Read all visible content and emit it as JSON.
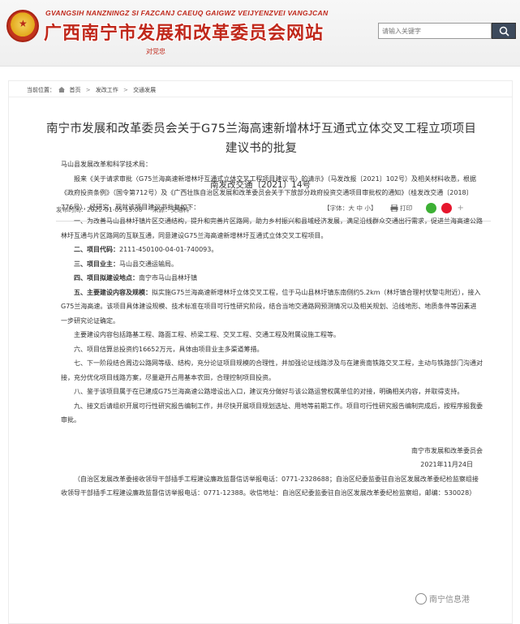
{
  "header": {
    "site_subtitle": "GVANGSIH NANZNINGZ SI FAZCANJ CAEUQ GAIGWZ VEIJYENZVEI VANGJCAN",
    "site_title": "广西南宁市发展和改革委员会网站",
    "slogan": "对党忠",
    "search_placeholder": "请输入关键字"
  },
  "breadcrumb": {
    "label": "当前位置：",
    "items": [
      "首页",
      "发改工作",
      "交通发展"
    ]
  },
  "document": {
    "title": "南宁市发展和改革委员会关于G75兰海高速新增林圩互通式立体交叉工程立项项目建议书的批复",
    "doc_number": "南发改交通〔2021〕14号",
    "publish_time": "发布时间：2022-01-05 15:08",
    "source": "来源：交通科",
    "font_size_tool": "【字体：大 中 小】",
    "print_label": "打印",
    "share_more": "+"
  },
  "body": {
    "addressee": "马山县发展改革和科学技术局：",
    "para1": "报来《关于请求审批〈G75兰海高速新增林圩互通式立体交叉工程项目建议书〉的请示》（马发改报〔2021〕102号）及相关材料收悉，根据《政府投资条例》（国令第712号）及《广西壮族自治区发展和改革委员会关于下放部分政府投资交通项目审批权的通知》（桂发改交通〔2018〕776号），经研究，现就该项目建议书批复如下：",
    "para2": "一、为改善马山县林圩镇片区交通结构，提升和完善片区路网，助力乡村振兴和县域经济发展，满足沿线群众交通出行需求，促进兰海高速公路林圩互通与片区路网的互联互通，同意建设G75兰海高速新增林圩互通式立体交叉工程项目。",
    "item2_label": "二、项目代码：",
    "item2_value": "2111-450100-04-01-740093。",
    "item3_label": "三、项目业主：",
    "item3_value": "马山县交通运输局。",
    "item4_label": "四、项目拟建设地点：",
    "item4_value": "南宁市马山县林圩镇",
    "item5_label": "五、主要建设内容及规模：",
    "item5_value": "拟实施G75兰海高速新增林圩立体交叉工程，位于马山县林圩镇东南侧约5.2km（林圩镇合理村伏黎屯附近），接入G75兰海高速。该项目具体建设规模、技术标准在项目可行性研究阶段，结合当地交通路网预测情况以及相关规划、沿线地形、地质条件等因素进一步研究论证确定。",
    "para_content": "主要建设内容包括路基工程、路面工程、桥梁工程、交叉工程、交通工程及附属设施工程等。",
    "para6": "六、项目估算总投资约16652万元，具体由项目业主多渠道筹措。",
    "para7": "七、下一阶段结合周边公路网等级、结构，充分论证项目规模的合理性，并加强论证线路涉及与在建贵南铁路交叉工程，主动与铁路部门沟通对接，充分优化项目线路方案，尽量避开占用基本农田，合理控制项目投资。",
    "para8": "八、鉴于该项目属于在已建成G75兰海高速公路增设出入口，建议充分做好与该公路运营权属单位的对接，明确相关内容，并取得支持。",
    "para9": "九、接文后请组织开展可行性研究报告编制工作，并尽快开展项目规划选址、用地等前期工作。项目可行性研究报告编制完成后，按程序报我委审批。",
    "signature": "南宁市发展和改革委员会",
    "date": "2021年11月24日",
    "footer_note": "（自治区发展改革委接收领导干部插手工程建设廉政监督信访举报电话：0771-2328688；自治区纪委监委驻自治区发展改革委纪检监察组接收领导干部插手工程建设廉政监督信访举报电话：0771-12388。收信地址：自治区纪委监委驻自治区发展改革委纪检监察组，邮编：530028）"
  },
  "watermark": "南宁信息港",
  "colors": {
    "brand_red": "#c0281b",
    "search_button": "#3d4a5c",
    "wechat_green": "#3cb034",
    "weibo_red": "#e6162d"
  }
}
